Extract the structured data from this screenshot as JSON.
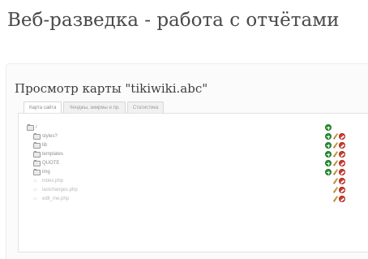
{
  "page": {
    "heading": "Веб-разведка - работа с отчётами"
  },
  "map": {
    "title": "Просмотр карты \"tikiwiki.abc\""
  },
  "tabs": [
    {
      "label": "Карта сайта",
      "active": true
    },
    {
      "label": "Ченджы, экмрмы и пр.",
      "active": false
    },
    {
      "label": "Статистика",
      "active": false
    }
  ],
  "tree": {
    "root": {
      "label": "/"
    },
    "items": [
      {
        "type": "folder",
        "label": "styles?",
        "can_add": true
      },
      {
        "type": "folder",
        "label": "lib",
        "can_add": true
      },
      {
        "type": "folder",
        "label": "templates",
        "can_add": true
      },
      {
        "type": "folder",
        "label": "QUOTE",
        "can_add": true
      },
      {
        "type": "folder",
        "label": "img",
        "can_add": true
      },
      {
        "type": "file",
        "label": "index.php",
        "can_add": false
      },
      {
        "type": "file",
        "label": "lastchanges.php",
        "can_add": false
      },
      {
        "type": "file",
        "label": "edit_me.php",
        "can_add": false
      }
    ]
  },
  "colors": {
    "add": "#2e9a36",
    "delete": "#d33b2f",
    "edit": "#c7a24a"
  },
  "icons": {
    "folder": "folder-icon",
    "file": "file-icon",
    "add": "add-icon",
    "edit": "edit-icon",
    "delete": "delete-icon"
  }
}
